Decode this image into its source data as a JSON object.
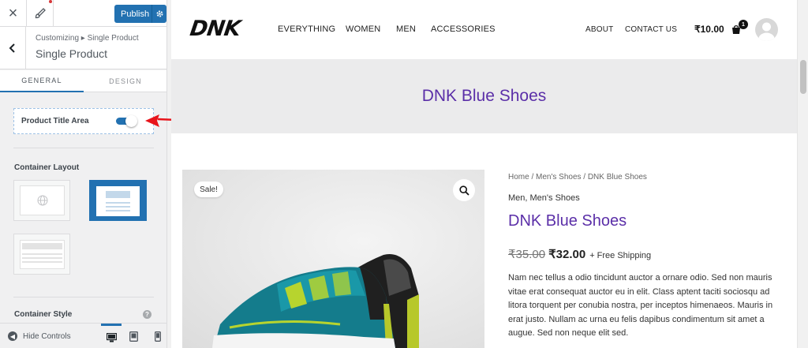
{
  "customizer": {
    "close_icon": "close-icon",
    "brush_icon": "paintbrush-icon",
    "publish_label": "Publish",
    "publish_gear_icon": "gear-icon",
    "back_icon": "chevron-left-icon",
    "breadcrumb": "Customizing ▸ Single Product",
    "panel_title": "Single Product",
    "tabs": [
      {
        "label": "GENERAL",
        "active": true
      },
      {
        "label": "DESIGN",
        "active": false
      }
    ],
    "product_title_area": {
      "label": "Product Title Area",
      "enabled": true
    },
    "container_layout": {
      "title": "Container Layout",
      "selected": "boxed"
    },
    "container_style": {
      "title": "Container Style"
    },
    "help_icon": "?",
    "footer": {
      "hide_controls_label": "Hide Controls",
      "devices": [
        "desktop",
        "tablet",
        "mobile"
      ],
      "active_device": "desktop"
    }
  },
  "site": {
    "logo": "DNK",
    "nav": [
      "EVERYTHING",
      "WOMEN",
      "MEN",
      "ACCESSORIES"
    ],
    "secondary_nav": [
      "ABOUT",
      "CONTACT US"
    ],
    "cart_total": "₹10.00",
    "cart_count": "1",
    "banner_title": "DNK Blue Shoes",
    "product": {
      "sale_badge": "Sale!",
      "breadcrumb": "Home / Men's Shoes / DNK Blue Shoes",
      "categories": "Men, Men's Shoes",
      "title": "DNK Blue Shoes",
      "old_price": "₹35.00",
      "new_price": "₹32.00",
      "shipping": "+ Free Shipping",
      "description": "Nam nec tellus a odio tincidunt auctor a ornare odio. Sed non mauris vitae erat consequat auctor eu in elit. Class aptent taciti sociosqu ad litora torquent per conubia nostra, per inceptos himenaeos. Mauris in erat justo. Nullam ac urna eu felis dapibus condimentum sit amet a augue. Sed non neque elit sed."
    }
  },
  "colors": {
    "accent": "#2271b1",
    "product_title": "#5b2fa8",
    "annotation_arrow": "#e8141b"
  }
}
